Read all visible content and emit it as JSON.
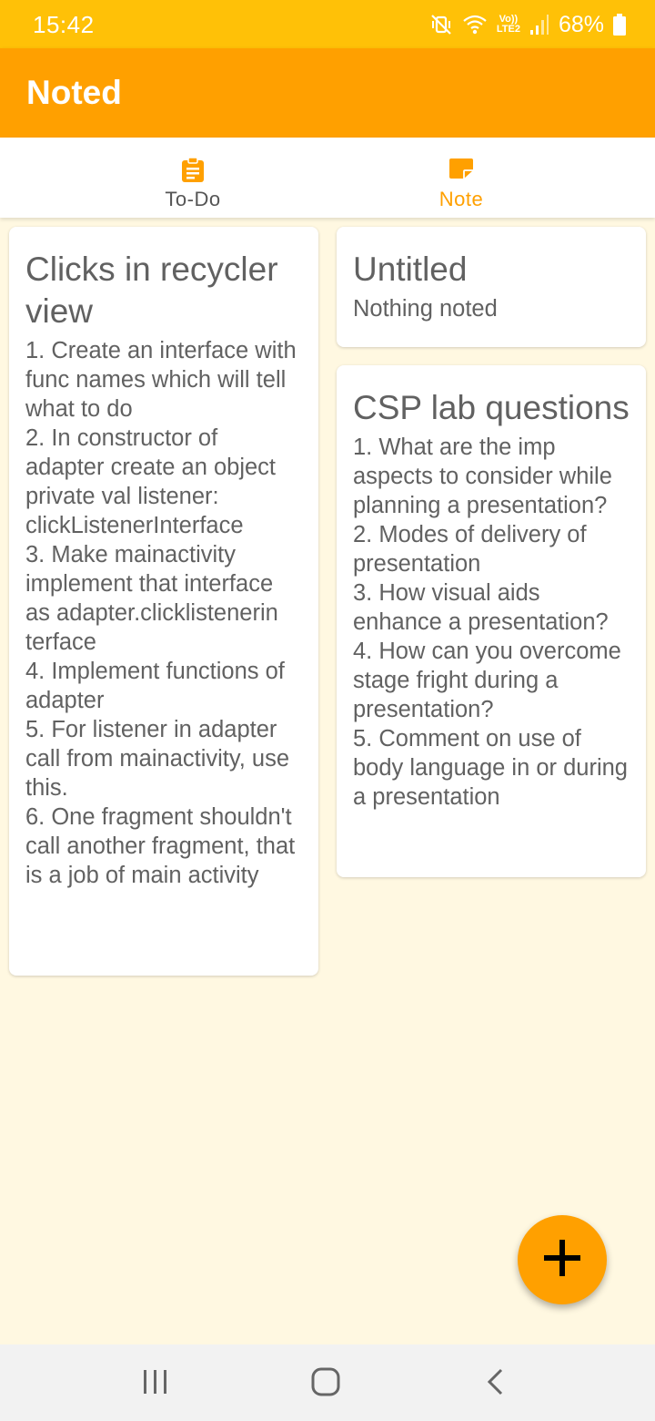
{
  "status_bar": {
    "time": "15:42",
    "network_label": "LTE2",
    "volte_label": "Vo))",
    "battery": "68%",
    "icons": [
      "mute-vibrate-icon",
      "wifi-icon",
      "signal-icon",
      "battery-icon"
    ]
  },
  "app_bar": {
    "title": "Noted",
    "color": "#FFA000"
  },
  "tabs": [
    {
      "label": "To-Do",
      "icon": "clipboard-icon",
      "selected": false
    },
    {
      "label": "Note",
      "icon": "note-icon",
      "selected": true
    }
  ],
  "notes": [
    {
      "title": "Clicks in recycler view",
      "body": "1. Create an interface with func names which will tell what to do\n2. In constructor of adapter create an object private val listener: clickListenerInterface\n3. Make mainactivity implement that interface as adapter.clicklistenerin terface\n4. Implement functions of adapter\n5. For listener in adapter call from mainactivity, use this.\n6. One fragment shouldn't call another fragment, that is a job of main activity"
    },
    {
      "title": "Untitled",
      "body": "Nothing noted"
    },
    {
      "title": "CSP lab questions",
      "body": "1. What are the imp aspects to consider while planning a presentation?\n2. Modes of delivery of presentation\n3. How visual aids enhance a presentation?\n4. How can you overcome stage fright during a presentation?\n5. Comment on use of body language in or during a presentation"
    }
  ],
  "fab": {
    "icon": "plus-icon"
  },
  "nav_bar": {
    "icons": [
      "recent-apps-icon",
      "home-icon",
      "back-icon"
    ]
  },
  "colors": {
    "status_bar": "#FFC107",
    "accent": "#FFA000",
    "background": "#FFF8E1"
  }
}
